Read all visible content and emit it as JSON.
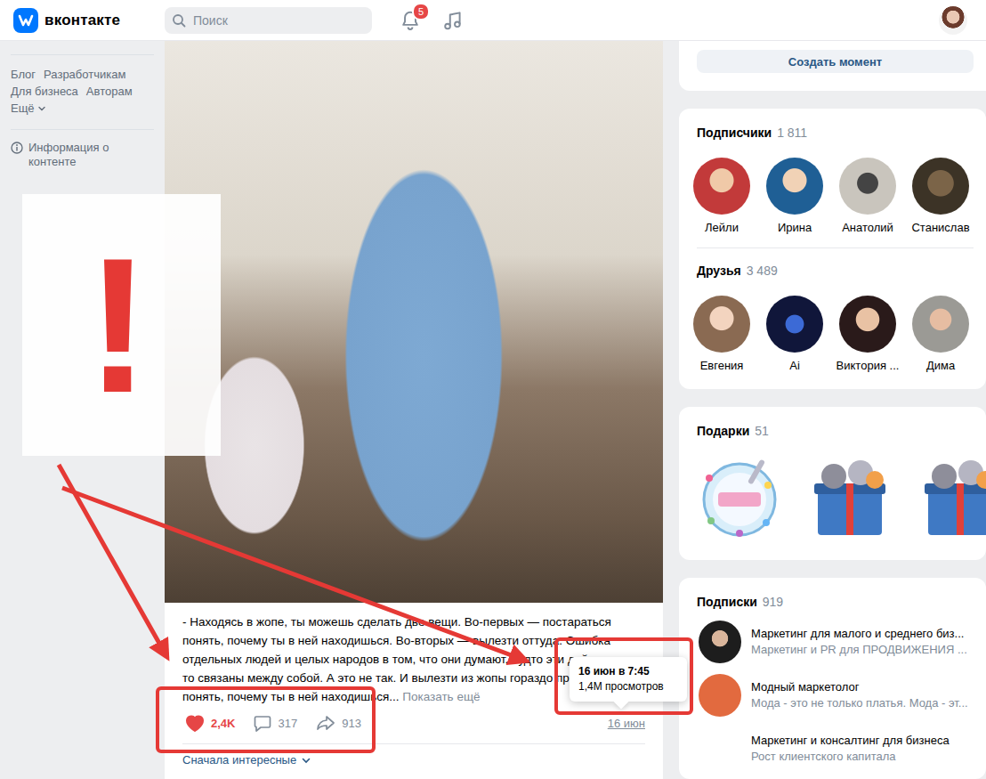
{
  "header": {
    "logo": "вконтакте",
    "search": {
      "placeholder": "Поиск"
    },
    "notifications": {
      "badge": "5"
    }
  },
  "sidebar": {
    "links": [
      "Блог",
      "Разработчикам",
      "Для бизнеса",
      "Авторам"
    ],
    "more": "Ещё",
    "info": "Информация о контенте"
  },
  "post": {
    "text": "- Находясь в жопе, ты можешь сделать две вещи. Во-первых — постараться понять, почему ты в ней находишься. Во-вторых — вылезти оттуда. Ошибка отдельных людей и целых народов в том, что они думают, будто эти действия как-то связаны между собой. А это не так. И вылезти из жопы гораздо проще, чем понять, почему ты в ней находишься...",
    "more": "Показать ещё",
    "likes": {
      "count": "2,4K",
      "liked": true
    },
    "comments": {
      "count": "317"
    },
    "shares": {
      "count": "913"
    },
    "date": "16 июн",
    "sort": "Сначала интересные"
  },
  "tooltip": {
    "datetime": "16 июн в 7:45",
    "views": "1,4M просмотров"
  },
  "annotation": {
    "mark": "!"
  },
  "moments": {
    "button": "Создать момент"
  },
  "followers": {
    "title": "Подписчики",
    "count": "1 811",
    "people": [
      {
        "name": "Лейли"
      },
      {
        "name": "Ирина"
      },
      {
        "name": "Анатолий"
      },
      {
        "name": "Станислав"
      }
    ]
  },
  "friends": {
    "title": "Друзья",
    "count": "3 489",
    "people": [
      {
        "name": "Евгения"
      },
      {
        "name": "Ai"
      },
      {
        "name": "Виктория ..."
      },
      {
        "name": "Дима"
      }
    ]
  },
  "gifts": {
    "title": "Подарки",
    "count": "51",
    "items": [
      {
        "kind": "cake"
      },
      {
        "kind": "box"
      },
      {
        "kind": "box"
      }
    ]
  },
  "subscriptions": {
    "title": "Подписки",
    "count": "919",
    "items": [
      {
        "title": "Маркетинг для малого и среднего биз...",
        "subtitle": "Маркетинг и PR для ПРОДВИЖЕНИЯ ..."
      },
      {
        "title": "Модный маркетолог",
        "subtitle": "Мода - это не только платья. Мода - эт..."
      },
      {
        "title": "Маркетинг и консалтинг для бизнеса",
        "subtitle": "Рост клиентского капитала"
      }
    ]
  }
}
